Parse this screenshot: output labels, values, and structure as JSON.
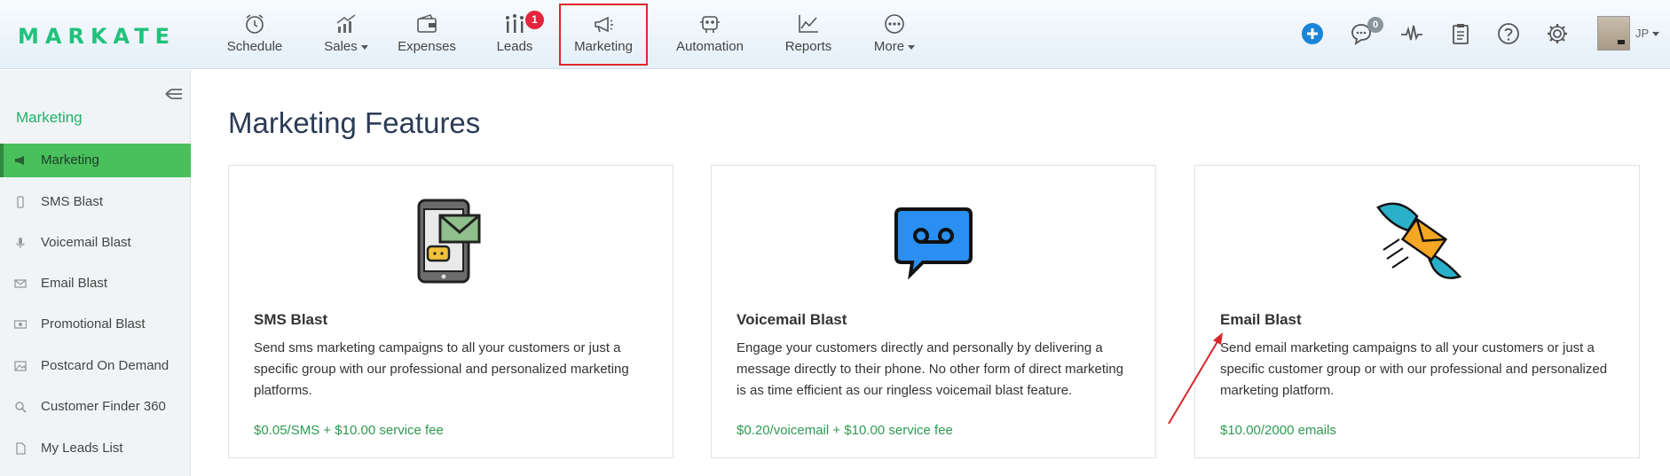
{
  "app": {
    "logo": "MARKATE"
  },
  "nav": {
    "items": [
      {
        "label": "Schedule",
        "icon": "alarm-clock-icon"
      },
      {
        "label": "Sales",
        "icon": "growth-chart-icon",
        "dropdown": true
      },
      {
        "label": "Expenses",
        "icon": "wallet-icon"
      },
      {
        "label": "Leads",
        "icon": "funnel-bars-icon",
        "badge": "1"
      },
      {
        "label": "Marketing",
        "icon": "megaphone-icon",
        "active": true
      },
      {
        "label": "Automation",
        "icon": "robot-icon"
      },
      {
        "label": "Reports",
        "icon": "line-chart-icon"
      },
      {
        "label": "More",
        "icon": "ellipsis-circle-icon",
        "dropdown": true
      }
    ],
    "right": {
      "chat_badge": "0",
      "user_initials": "JP"
    }
  },
  "sidebar": {
    "title": "Marketing",
    "items": [
      {
        "label": "Marketing",
        "icon": "megaphone-icon",
        "active": true
      },
      {
        "label": "SMS Blast",
        "icon": "phone-icon"
      },
      {
        "label": "Voicemail Blast",
        "icon": "microphone-icon"
      },
      {
        "label": "Email Blast",
        "icon": "envelope-icon"
      },
      {
        "label": "Promotional Blast",
        "icon": "banknote-icon"
      },
      {
        "label": "Postcard On Demand",
        "icon": "picture-icon"
      },
      {
        "label": "Customer Finder 360",
        "icon": "search-icon"
      },
      {
        "label": "My Leads List",
        "icon": "document-icon"
      }
    ]
  },
  "main": {
    "title": "Marketing Features",
    "cards": [
      {
        "title": "SMS Blast",
        "description": "Send sms marketing campaigns to all your customers or just a specific group with our professional and personalized marketing platforms.",
        "price": "$0.05/SMS + $10.00 service fee",
        "icon": "phone-message-icon"
      },
      {
        "title": "Voicemail Blast",
        "description": "Engage your customers directly and personally by delivering a message directly to their phone. No other form of direct marketing is as time efficient as our ringless voicemail blast feature.",
        "price": "$0.20/voicemail + $10.00 service fee",
        "icon": "voicemail-bubble-icon"
      },
      {
        "title": "Email Blast",
        "description": "Send email marketing campaigns to all your customers or just a specific customer group or with our professional and personalized marketing platform.",
        "price": "$10.00/2000 emails",
        "icon": "flying-envelope-icon"
      }
    ]
  },
  "colors": {
    "brand_green": "#20c27a",
    "active_sidebar": "#49c05b",
    "price_green": "#2e9a52",
    "highlight_red": "#e0262b",
    "add_blue": "#1a84d8"
  }
}
